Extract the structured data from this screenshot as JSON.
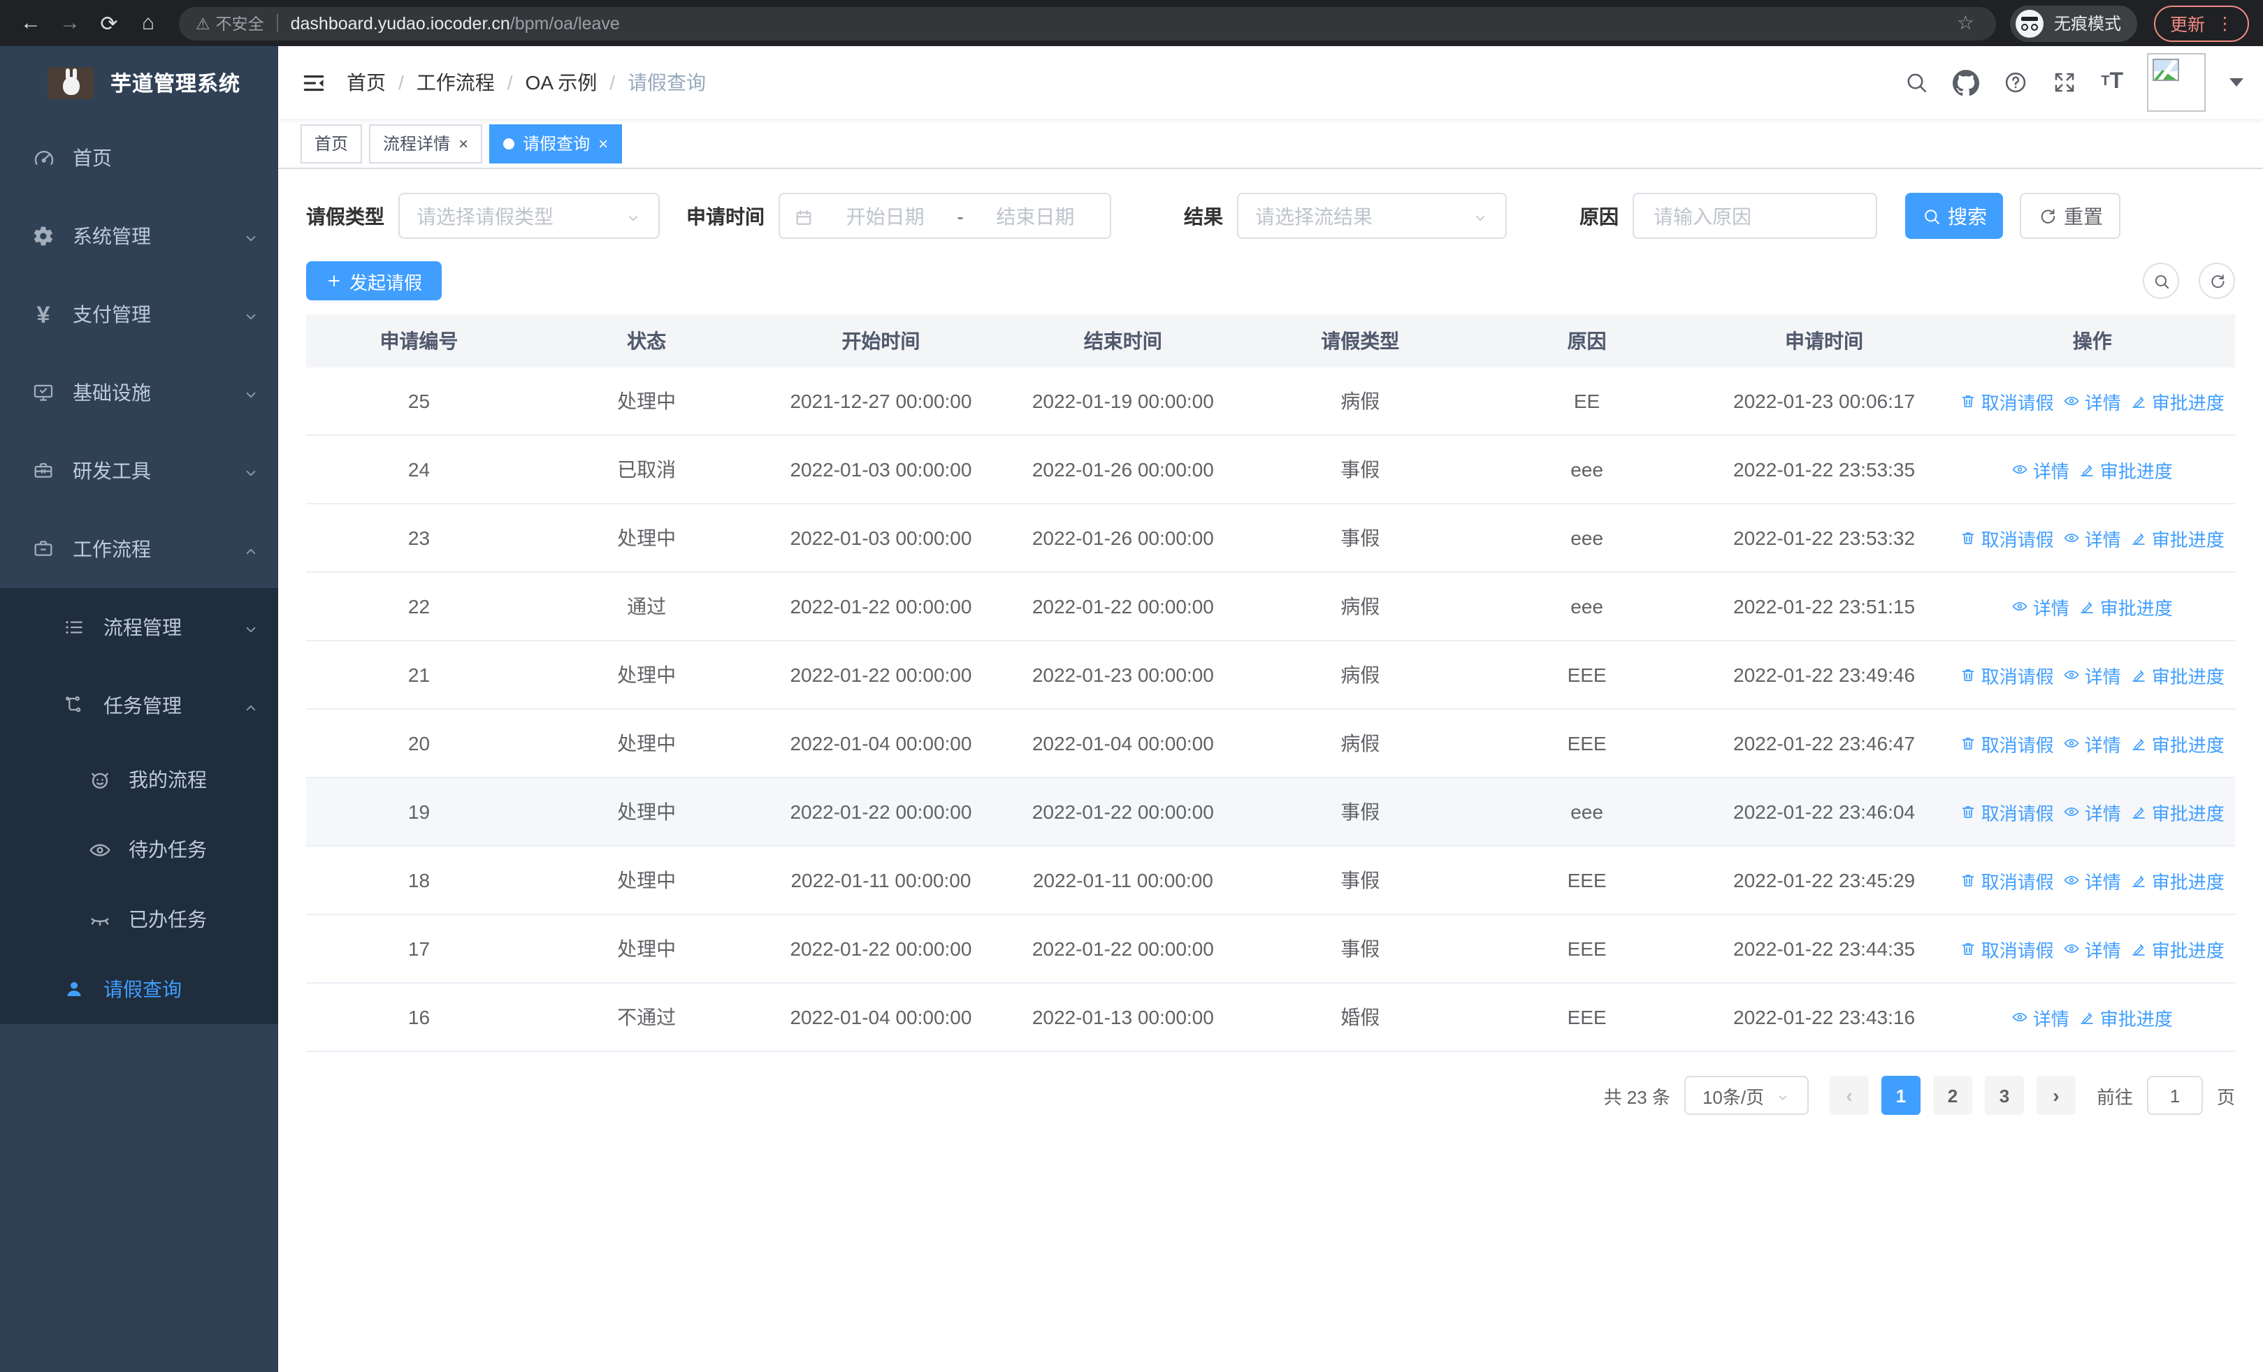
{
  "icons": {
    "back": "←",
    "forward": "→",
    "reload": "⟳",
    "home": "⌂",
    "star": "☆",
    "warning": "⚠",
    "dots": "⋮",
    "close": "×",
    "yen": "¥",
    "prev": "‹",
    "next": "›",
    "font_t_small": "T",
    "font_t_big": "T"
  },
  "browser": {
    "insecure_label": "不安全",
    "url_host": "dashboard.yudao.iocoder.cn",
    "url_path": "/bpm/oa/leave",
    "incognito_label": "无痕模式",
    "update_label": "更新"
  },
  "sidebar": {
    "title": "芋道管理系统",
    "items": {
      "home": "首页",
      "system": "系统管理",
      "pay": "支付管理",
      "infra": "基础设施",
      "dev": "研发工具",
      "workflow": "工作流程",
      "process": "流程管理",
      "task": "任务管理",
      "my_process": "我的流程",
      "todo": "待办任务",
      "done": "已办任务",
      "leave": "请假查询"
    }
  },
  "header": {
    "breadcrumb": [
      "首页",
      "工作流程",
      "OA 示例",
      "请假查询"
    ],
    "breadcrumb_separator": "/"
  },
  "tabs": {
    "items": [
      {
        "label": "首页"
      },
      {
        "label": "流程详情"
      },
      {
        "label": "请假查询"
      }
    ]
  },
  "filter": {
    "type_label": "请假类型",
    "type_placeholder": "请选择请假类型",
    "time_label": "申请时间",
    "start_placeholder": "开始日期",
    "range_separator": "-",
    "end_placeholder": "结束日期",
    "result_label": "结果",
    "result_placeholder": "请选择流结果",
    "reason_label": "原因",
    "reason_placeholder": "请输入原因",
    "search_label": "搜索",
    "reset_label": "重置"
  },
  "toolbar": {
    "create_label": "发起请假"
  },
  "table": {
    "columns": [
      "申请编号",
      "状态",
      "开始时间",
      "结束时间",
      "请假类型",
      "原因",
      "申请时间",
      "操作"
    ],
    "actions": {
      "cancel": "取消请假",
      "detail": "详情",
      "progress": "审批进度"
    },
    "rows": [
      {
        "id": "25",
        "status": "处理中",
        "start": "2021-12-27 00:00:00",
        "end": "2022-01-19 00:00:00",
        "type": "病假",
        "reason": "EE",
        "apply": "2022-01-23 00:06:17"
      },
      {
        "id": "24",
        "status": "已取消",
        "start": "2022-01-03 00:00:00",
        "end": "2022-01-26 00:00:00",
        "type": "事假",
        "reason": "eee",
        "apply": "2022-01-22 23:53:35"
      },
      {
        "id": "23",
        "status": "处理中",
        "start": "2022-01-03 00:00:00",
        "end": "2022-01-26 00:00:00",
        "type": "事假",
        "reason": "eee",
        "apply": "2022-01-22 23:53:32"
      },
      {
        "id": "22",
        "status": "通过",
        "start": "2022-01-22 00:00:00",
        "end": "2022-01-22 00:00:00",
        "type": "病假",
        "reason": "eee",
        "apply": "2022-01-22 23:51:15"
      },
      {
        "id": "21",
        "status": "处理中",
        "start": "2022-01-22 00:00:00",
        "end": "2022-01-23 00:00:00",
        "type": "病假",
        "reason": "EEE",
        "apply": "2022-01-22 23:49:46"
      },
      {
        "id": "20",
        "status": "处理中",
        "start": "2022-01-04 00:00:00",
        "end": "2022-01-04 00:00:00",
        "type": "病假",
        "reason": "EEE",
        "apply": "2022-01-22 23:46:47"
      },
      {
        "id": "19",
        "status": "处理中",
        "start": "2022-01-22 00:00:00",
        "end": "2022-01-22 00:00:00",
        "type": "事假",
        "reason": "eee",
        "apply": "2022-01-22 23:46:04"
      },
      {
        "id": "18",
        "status": "处理中",
        "start": "2022-01-11 00:00:00",
        "end": "2022-01-11 00:00:00",
        "type": "事假",
        "reason": "EEE",
        "apply": "2022-01-22 23:45:29"
      },
      {
        "id": "17",
        "status": "处理中",
        "start": "2022-01-22 00:00:00",
        "end": "2022-01-22 00:00:00",
        "type": "事假",
        "reason": "EEE",
        "apply": "2022-01-22 23:44:35"
      },
      {
        "id": "16",
        "status": "不通过",
        "start": "2022-01-04 00:00:00",
        "end": "2022-01-13 00:00:00",
        "type": "婚假",
        "reason": "EEE",
        "apply": "2022-01-22 23:43:16"
      }
    ]
  },
  "pagination": {
    "total_label": "共 23 条",
    "page_size": "10条/页",
    "pages": [
      "1",
      "2",
      "3"
    ],
    "goto_label": "前往",
    "goto_value": "1",
    "unit_label": "页"
  },
  "colors": {
    "primary": "#409eff",
    "sidebar_bg": "#304156",
    "submenu_bg": "#1f2d3d",
    "update_accent": "#f28b82"
  }
}
